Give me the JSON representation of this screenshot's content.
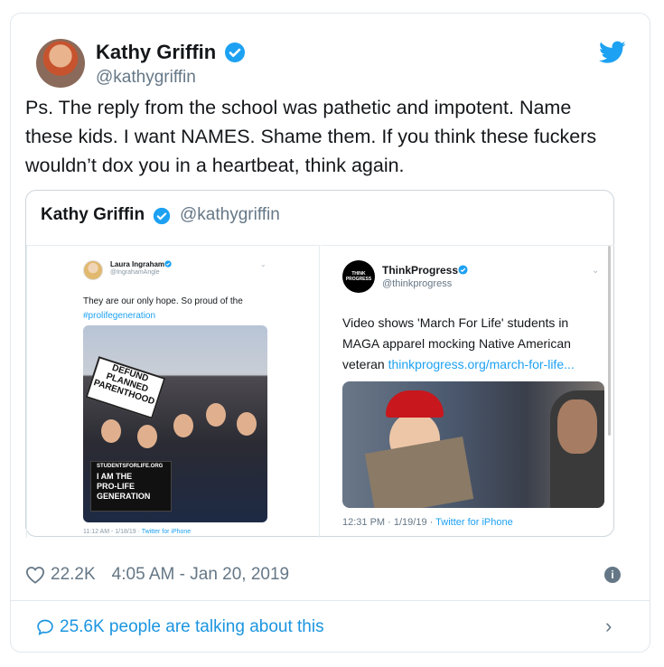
{
  "tweet": {
    "author_name": "Kathy Griffin",
    "author_handle": "@kathygriffin",
    "text": "Ps. The reply from the school was pathetic and impotent. Name these kids. I want NAMES. Shame them. If you think these fuckers wouldn’t dox you in a heartbeat, think again.",
    "likes": "22.2K",
    "timestamp": "4:05 AM - Jan 20, 2019",
    "talking": "25.6K people are talking about this"
  },
  "quoted": {
    "author_name": "Kathy Griffin",
    "author_handle": "@kathygriffin",
    "left": {
      "name": "Laura Ingraham",
      "handle": "@IngrahamAngle",
      "text": "They are our only hope. So proud of the",
      "hashtag": "#prolifegeneration",
      "sign1": [
        "DEFUND",
        "PLANNED",
        "PARENTHOOD"
      ],
      "sign2": [
        "STUDENTSFORLIFE.ORG",
        "I AM THE",
        "PRO-LIFE",
        "GENERATION"
      ],
      "meta_time": "11:12 AM - 1/18/19 · ",
      "meta_via": "Twitter for iPhone"
    },
    "right": {
      "logo": "THINK PROGRESS",
      "name": "ThinkProgress",
      "handle": "@thinkprogress",
      "text": "Video shows 'March For Life' students in MAGA apparel mocking Native American veteran ",
      "link": "thinkprogress.org/march-for-life...",
      "meta_time": "12:31 PM · 1/19/19 · ",
      "meta_via": "Twitter for iPhone"
    }
  },
  "colors": {
    "accent": "#1da1f2",
    "muted": "#657786",
    "border": "#e1e8ed"
  },
  "icons": [
    "verified-icon",
    "twitter-bird-icon",
    "heart-icon",
    "info-icon",
    "comment-bubble-icon",
    "chevron-right-icon",
    "chevron-down-icon"
  ]
}
